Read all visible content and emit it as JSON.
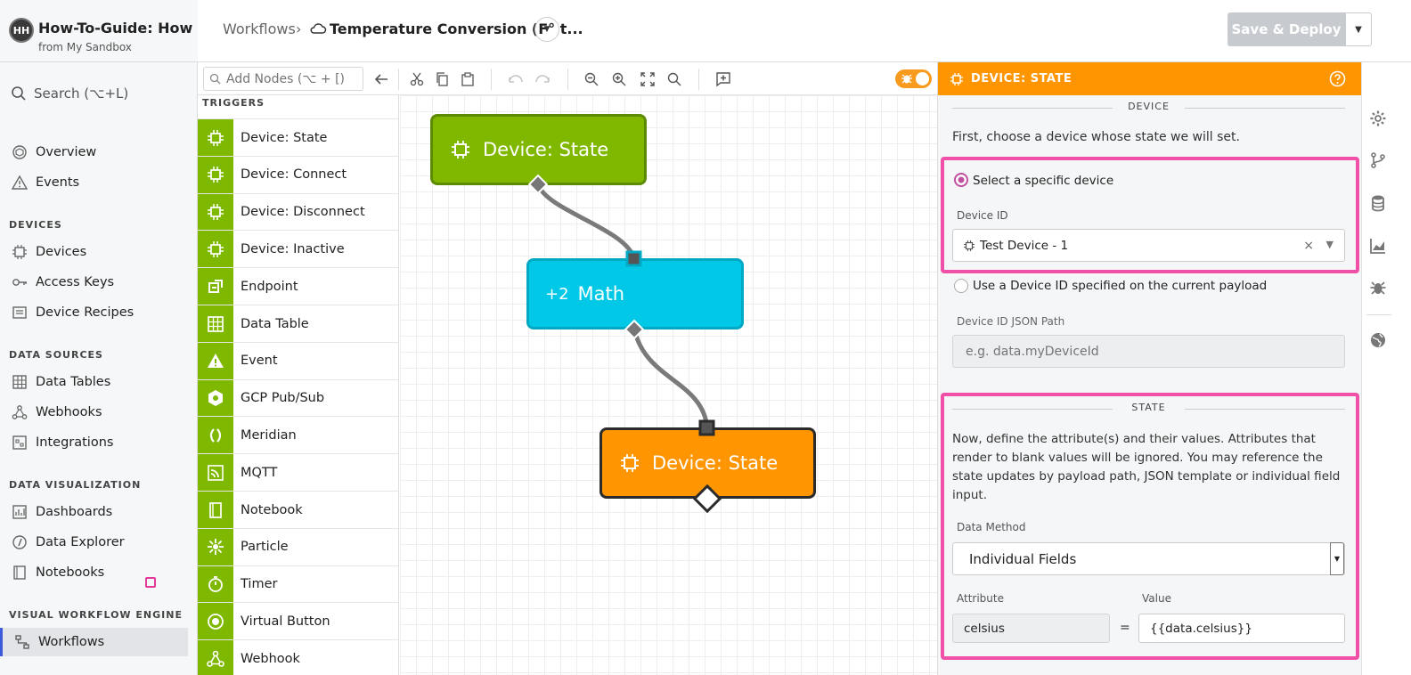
{
  "app": {
    "avatar": "HH",
    "title": "How-To-Guide: How to...",
    "subtitle": "from My Sandbox"
  },
  "sidebar": {
    "search": "Search (⌥+L)",
    "items": [
      {
        "label": "Overview"
      },
      {
        "label": "Events"
      }
    ],
    "sections": [
      {
        "title": "DEVICES",
        "items": [
          "Devices",
          "Access Keys",
          "Device Recipes"
        ]
      },
      {
        "title": "DATA SOURCES",
        "items": [
          "Data Tables",
          "Webhooks",
          "Integrations"
        ]
      },
      {
        "title": "DATA VISUALIZATION",
        "items": [
          "Dashboards",
          "Data Explorer",
          "Notebooks"
        ]
      },
      {
        "title": "VISUAL WORKFLOW ENGINE",
        "items": [
          "Workflows"
        ]
      }
    ]
  },
  "header": {
    "crumb_root": "Workflows",
    "crumb_sep": "›",
    "title": "Temperature Conversion (F° t...",
    "save_label": "Save & Deploy"
  },
  "toolbar": {
    "add_nodes_placeholder": "Add Nodes (⌥ + [)"
  },
  "palette": {
    "heading": "TRIGGERS",
    "items": [
      "Device: State",
      "Device: Connect",
      "Device: Disconnect",
      "Device: Inactive",
      "Endpoint",
      "Data Table",
      "Event",
      "GCP Pub/Sub",
      "Meridian",
      "MQTT",
      "Notebook",
      "Particle",
      "Timer",
      "Virtual Button",
      "Webhook"
    ]
  },
  "canvas": {
    "nodes": [
      {
        "label": "Device: State",
        "color": "#80b800"
      },
      {
        "prefix": "+2",
        "label": "Math",
        "color": "#00c8e6"
      },
      {
        "label": "Device: State",
        "color": "#ff9500"
      }
    ]
  },
  "panel": {
    "title": "DEVICE: STATE",
    "device_section": "DEVICE",
    "device_help": "First, choose a device whose state we will set.",
    "radio_specific": "Select a specific device",
    "device_id_label": "Device ID",
    "device_id_value": "Test Device - 1",
    "clear": "×",
    "radio_payload": "Use a Device ID specified on the current payload",
    "json_path_label": "Device ID JSON Path",
    "json_path_placeholder": "e.g. data.myDeviceId",
    "state_section": "STATE",
    "state_help": "Now, define the attribute(s) and their values. Attributes that render to blank values will be ignored. You may reference the state updates by payload path, JSON template or individual field input.",
    "data_method_label": "Data Method",
    "data_method_value": "Individual Fields",
    "attribute_label": "Attribute",
    "value_label": "Value",
    "attribute_value": "celsius",
    "equals": "=",
    "value_value": "{{data.celsius}}"
  },
  "colors": {
    "accent": "#ff9500",
    "trigger": "#80b800",
    "highlight": "#f050a8"
  }
}
